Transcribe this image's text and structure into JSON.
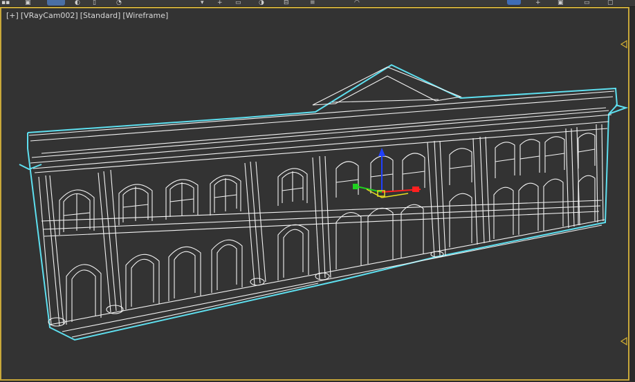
{
  "viewport": {
    "labels": [
      "[+]",
      "[VRayCam002]",
      "[Standard]",
      "[Wireframe]"
    ]
  },
  "colors": {
    "viewport_bg": "#333333",
    "active_border": "#c8a83a",
    "wire_primary": "#ffffff",
    "wire_selected": "#5ee0f0",
    "gizmo_x": "#ff2020",
    "gizmo_y": "#20d020",
    "gizmo_z": "#2040ff",
    "gizmo_plane": "#e8e020"
  },
  "icons": {
    "marker_top": "triangle-left-icon",
    "marker_bottom": "triangle-left-icon"
  }
}
